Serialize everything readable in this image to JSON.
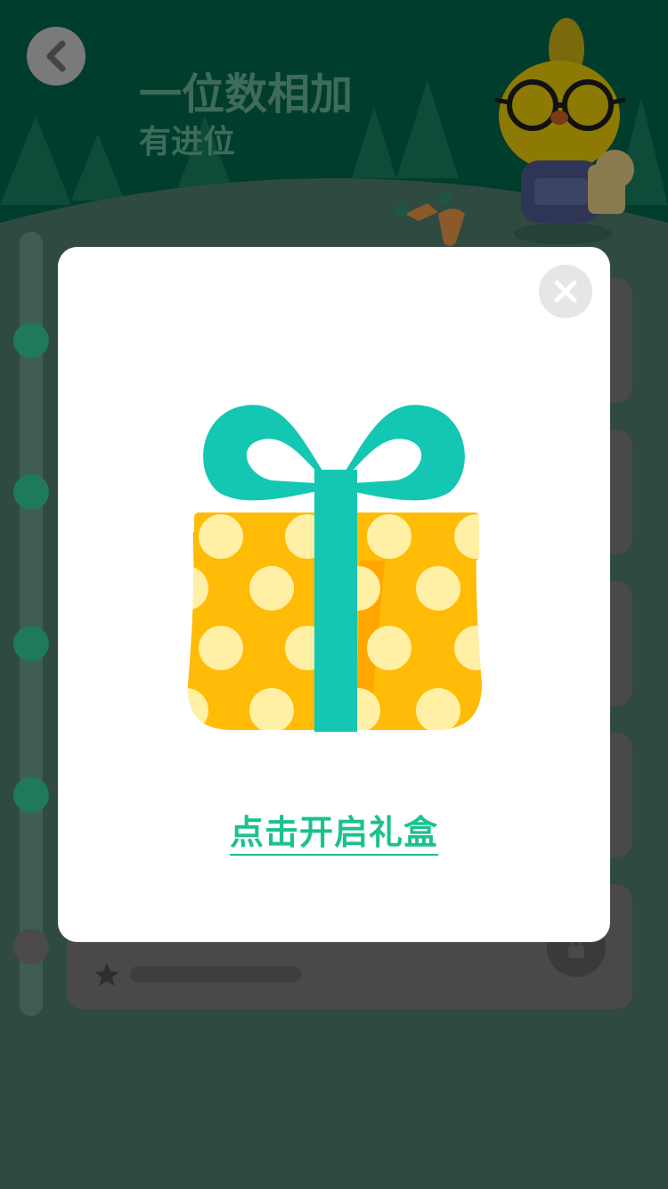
{
  "header": {
    "title": "一位数相加",
    "subtitle": "有进位"
  },
  "modal": {
    "open_gift_label": "点击开启礼盒"
  },
  "colors": {
    "accent": "#1bc18e",
    "ribbon": "#13c7b3",
    "box": "#ffbb05",
    "overlay_bg": "#2f4a41"
  }
}
